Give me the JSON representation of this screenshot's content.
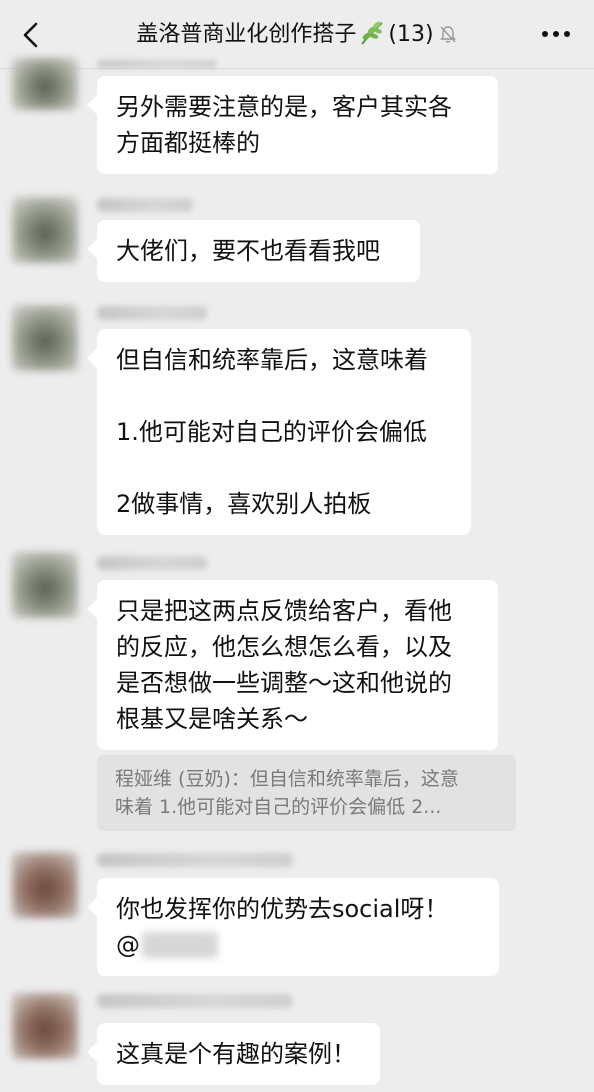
{
  "header": {
    "title": "盖洛普商业化创作搭子",
    "member_count": "(13)",
    "back_icon": "chevron-left-icon",
    "leaf_icon": "herb-leaf-icon",
    "mute_icon": "bell-muted-icon",
    "more_icon": "more-dots-icon"
  },
  "messages": [
    {
      "lines": [
        "另外需要注意的是，客户其实各",
        "方面都挺棒的"
      ]
    },
    {
      "lines": [
        "大佬们，要不也看看我吧"
      ]
    },
    {
      "lines": [
        "但自信和统率靠后，这意味着",
        "",
        "1.他可能对自己的评价会偏低",
        "",
        "2做事情，喜欢别人拍板"
      ]
    },
    {
      "lines": [
        "只是把这两点反馈给客户，看他",
        "的反应，他怎么想怎么看，以及",
        "是否想做一些调整～这和他说的",
        "根基又是啥关系～"
      ]
    },
    {
      "lines": [
        "你也发挥你的优势去social呀！"
      ],
      "mention_prefix": "@"
    },
    {
      "lines": [
        "这真是个有趣的案例！"
      ]
    }
  ],
  "quote": {
    "lines": [
      "程娅维 (豆奶)：但自信和统率靠后，这意",
      "味着  1.他可能对自己的评价会偏低  2..."
    ]
  },
  "colors": {
    "background": "#ededed",
    "bubble": "#ffffff",
    "quote_bg": "#e2e2e2",
    "quote_text": "#7a7a7a"
  }
}
